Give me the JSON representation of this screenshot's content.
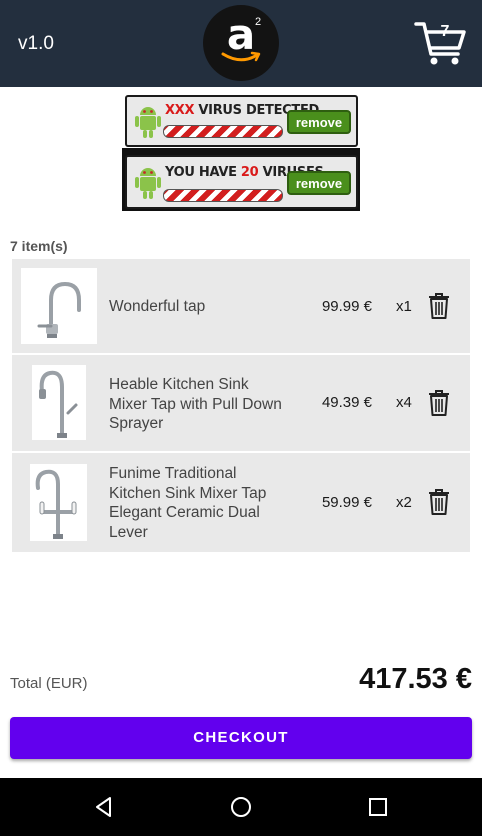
{
  "app": {
    "version": "v1.0",
    "logo_letter": "a",
    "logo_superscript": "2",
    "cart_badge_count": "7"
  },
  "ads": [
    {
      "text_prefix": "",
      "text_highlight": "XXX",
      "text_main": " VIRUS DETECTED",
      "button_label": "remove"
    },
    {
      "text_prefix": "YOU HAVE ",
      "text_highlight": "20",
      "text_main": " VIRUSES",
      "button_label": "remove"
    }
  ],
  "cart": {
    "item_count_label": "7 item(s)",
    "items": [
      {
        "name": "Wonderful tap",
        "price": "99.99 €",
        "quantity": "x1"
      },
      {
        "name": "Heable Kitchen Sink Mixer Tap with Pull Down Sprayer",
        "price": "49.39 €",
        "quantity": "x4"
      },
      {
        "name": "Funime Traditional Kitchen Sink Mixer Tap Elegant Ceramic Dual Lever",
        "price": "59.99 €",
        "quantity": "x2"
      }
    ],
    "total_label": "Total (EUR)",
    "total_value": "417.53 €",
    "checkout_label": "CHECKOUT"
  },
  "icons": {
    "cart": "shopping-cart-icon",
    "delete": "trash-icon",
    "nav_back": "back-triangle-icon",
    "nav_home": "home-circle-icon",
    "nav_recents": "recents-square-icon"
  },
  "colors": {
    "appbar": "#232f3e",
    "checkout": "#6200ee",
    "row_background": "#e9e9e9",
    "ad_remove": "#4a8f1c",
    "ad_highlight": "#d91a1a"
  }
}
